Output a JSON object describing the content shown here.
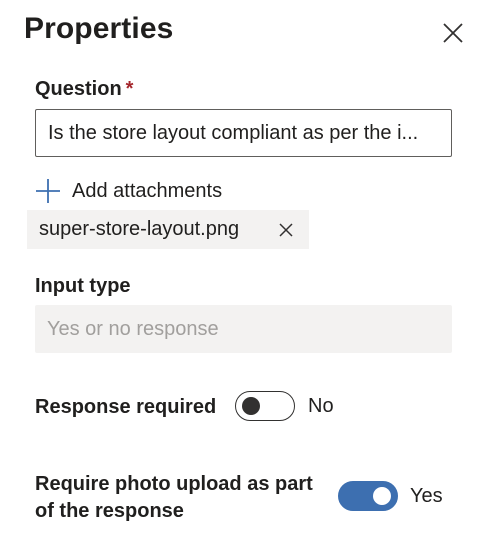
{
  "panel": {
    "title": "Properties",
    "close_icon": "close-icon"
  },
  "question": {
    "label": "Question",
    "required_marker": "*",
    "value": "Is the store layout compliant as per the image provided?",
    "display_value": "Is the store layout compliant as per the i..."
  },
  "attachments": {
    "add_label": "Add attachments",
    "add_icon": "plus-icon",
    "files": [
      {
        "name": "super-store-layout.png",
        "remove_icon": "close-icon"
      }
    ]
  },
  "input_type": {
    "label": "Input type",
    "placeholder": "Yes or no response"
  },
  "response_required": {
    "label": "Response required",
    "state": false,
    "state_label": "No"
  },
  "photo_upload": {
    "label_line1": "Require photo upload as part",
    "label_line2": "of the response",
    "state": true,
    "state_label": "Yes"
  },
  "colors": {
    "accent": "#3d6fb0",
    "required": "#a4262c",
    "text": "#201f1e",
    "field_bg": "#f3f2f1",
    "placeholder": "#a19f9d"
  }
}
